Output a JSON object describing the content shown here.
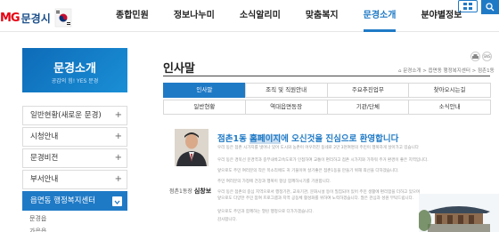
{
  "header": {
    "logo_mg": "MG",
    "logo_city": "문경시",
    "nav": [
      {
        "label": "종합민원",
        "active": false
      },
      {
        "label": "정보나누미",
        "active": false
      },
      {
        "label": "소식알리미",
        "active": false
      },
      {
        "label": "맞춤복지",
        "active": false
      },
      {
        "label": "문경소개",
        "active": true
      },
      {
        "label": "분야별정보",
        "active": false
      }
    ]
  },
  "sidebar": {
    "title": "문경소개",
    "subtitle": "공감의 힘! YES 문경",
    "items": [
      {
        "label": "일반현황(새로운 문경)",
        "active": false
      },
      {
        "label": "시청안내",
        "active": false
      },
      {
        "label": "문경비전",
        "active": false
      },
      {
        "label": "부서안내",
        "active": false
      },
      {
        "label": "읍면동 행정복지센터",
        "active": true
      }
    ],
    "sub_items": [
      "문경읍",
      "가은읍"
    ]
  },
  "main": {
    "title": "인사말",
    "breadcrumb": "문경소개 > 읍면동 행정복지센터 > 점촌1동",
    "title_icons": [
      "print-icon",
      "sns-icon"
    ],
    "sns_label": "SNS",
    "tabs_row1": [
      "인사말",
      "조직 및 직원안내",
      "주요추진업무",
      "찾아오시는길"
    ],
    "tabs_row2": [
      "일반현황",
      "역대읍면동장",
      "기관/단체",
      "소식안내"
    ],
    "active_tab": "인사말"
  },
  "greeting": {
    "headline_pre": "점촌1동 ",
    "headline_hl": "홈페이지",
    "headline_post": "에 오신것을 진심으로 환영합니다",
    "caption_role": "점촌1동장",
    "caption_name": "심창보",
    "paragraphs": [
      "우리 동은 점촌 시가지를 벗어나 있어 도시와 농촌이 어우러진 동네로 2만 3천여명의 주민이 행복하게 살아가고 있습니다",
      "우리 동은 경북선 문경역과 중부내륙고속도로가 인접하여 교통이 편리하고 점촌 시가지와 가까워 주거 환경이 좋은 지역입니다.",
      "앞으로도 주민 여러분의 작은 목소리에도 귀 기울이며 살기좋은 점촌1동을 만들기 위해 최선을 다하겠습니다.",
      "주민 여러분의 가정에 건강과 행복이 항상 함께하시기를 기원합니다.",
      "우리 동은 점촌의 중심 지역으로서 행정기관, 교육기관, 문화시설 등이 밀집되어 있어 주민 생활에 편리함을 더하고 있으며 앞으로도 다양한 주민 참여 프로그램과 지역 공동체 활성화를 위하여 노력하겠습니다. 많은 관심과 성원 부탁드립니다.",
      "앞으로도 주민과 함께하는 열린 행정으로 다가가겠습니다.",
      "감사합니다."
    ]
  }
}
